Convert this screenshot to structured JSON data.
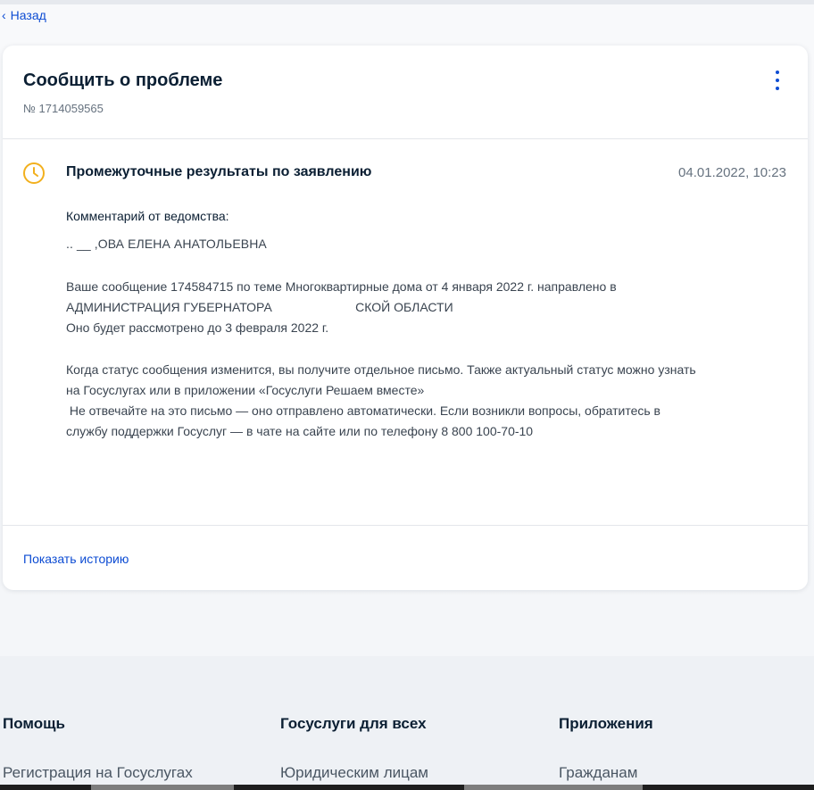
{
  "nav": {
    "back_label": "Назад"
  },
  "card": {
    "title": "Сообщить о проблеме",
    "number": "№ 1714059565",
    "menu_icon": "kebab-icon",
    "status": {
      "icon": "clock-icon",
      "title": "Промежуточные результаты по заявлению",
      "date": "04.01.2022, 10:23",
      "comment_label": "Комментарий от ведомства:",
      "officer_name": ".. __ ,ОВА ЕЛЕНА АНАТОЛЬЕВНА",
      "message_line_1": "Ваше сообщение 174584715 по теме Многоквартирные дома от 4 января 2022 г. направлено в",
      "message_line_2": "АДМИНИСТРАЦИЯ ГУБЕРНАТОРА                        СКОЙ ОБЛАСТИ",
      "message_line_3": "Оно будет рассмотрено до 3 февраля 2022 г.",
      "info_line_1": "Когда статус сообщения изменится, вы получите отдельное письмо. Также актуальный статус можно узнать",
      "info_line_2": "на Госуслугах или в приложении «Госуслуги Решаем вместе»",
      "info_line_3": " Не отвечайте на это письмо — оно отправлено автоматически. Если возникли вопросы, обратитесь в",
      "info_line_4": "службу поддержки Госуслуг — в чате на сайте или по телефону 8 800 100-70-10"
    },
    "history_link": "Показать историю"
  },
  "footer": {
    "columns": [
      {
        "heading": "Помощь",
        "link": "Регистрация на Госуслугах"
      },
      {
        "heading": "Госуслуги для всех",
        "link": "Юридическим лицам"
      },
      {
        "heading": "Приложения",
        "link": "Гражданам"
      }
    ]
  },
  "colors": {
    "accent": "#0d4cd3",
    "status_icon": "#f2b01e",
    "text_primary": "#0b1f33",
    "text_secondary": "#66727f",
    "footer_bg": "#eef1f5"
  }
}
